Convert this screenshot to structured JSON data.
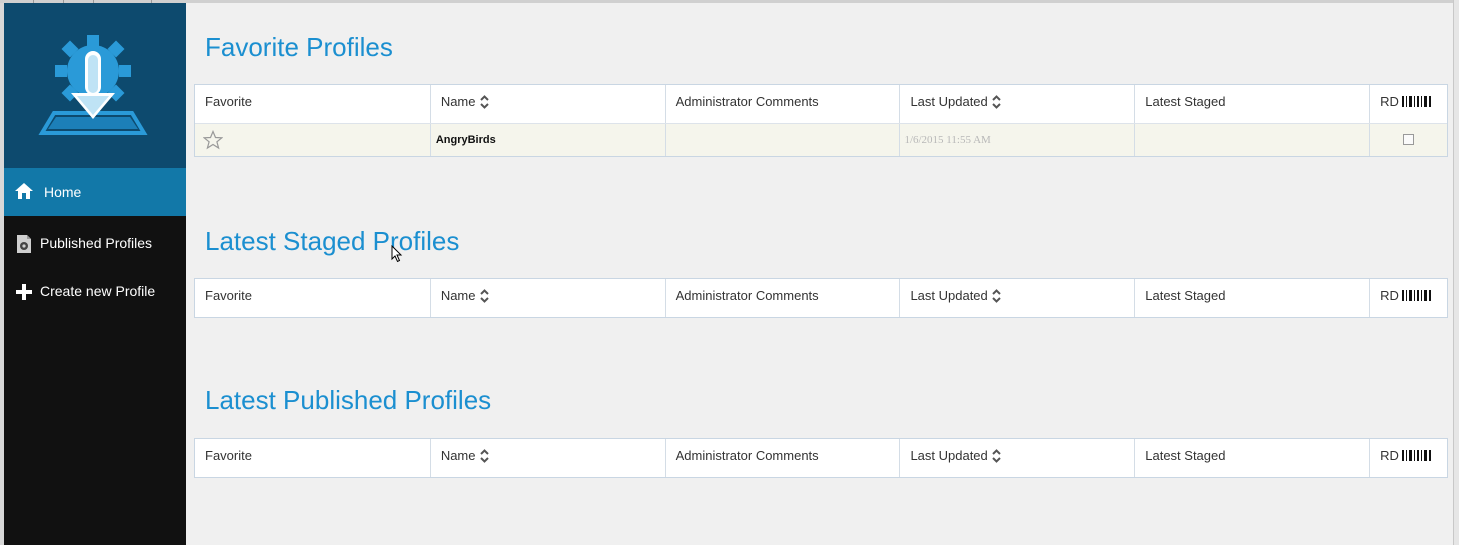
{
  "sidebar": {
    "items": [
      {
        "label": "Home",
        "icon": "home-icon",
        "active": true
      },
      {
        "label": "Published Profiles",
        "icon": "document-gear-icon",
        "active": false
      },
      {
        "label": "Create new Profile",
        "icon": "plus-icon",
        "active": false
      }
    ]
  },
  "columns": {
    "favorite": "Favorite",
    "name": "Name",
    "comments": "Administrator Comments",
    "updated": "Last Updated",
    "staged": "Latest Staged",
    "rd": "RD"
  },
  "sections": [
    {
      "title": "Favorite Profiles",
      "rows": [
        {
          "favorite": false,
          "name": "AngryBirds",
          "comments": "",
          "updated": "1/6/2015 11:55 AM",
          "staged": "",
          "rd": false
        }
      ]
    },
    {
      "title": "Latest Staged Profiles",
      "rows": []
    },
    {
      "title": "Latest Published Profiles",
      "rows": []
    }
  ],
  "colors": {
    "accent": "#1b8fd0",
    "nav_active": "#1278a8",
    "logo_bg": "#0d4a6e",
    "sidebar_bg": "#111111"
  }
}
